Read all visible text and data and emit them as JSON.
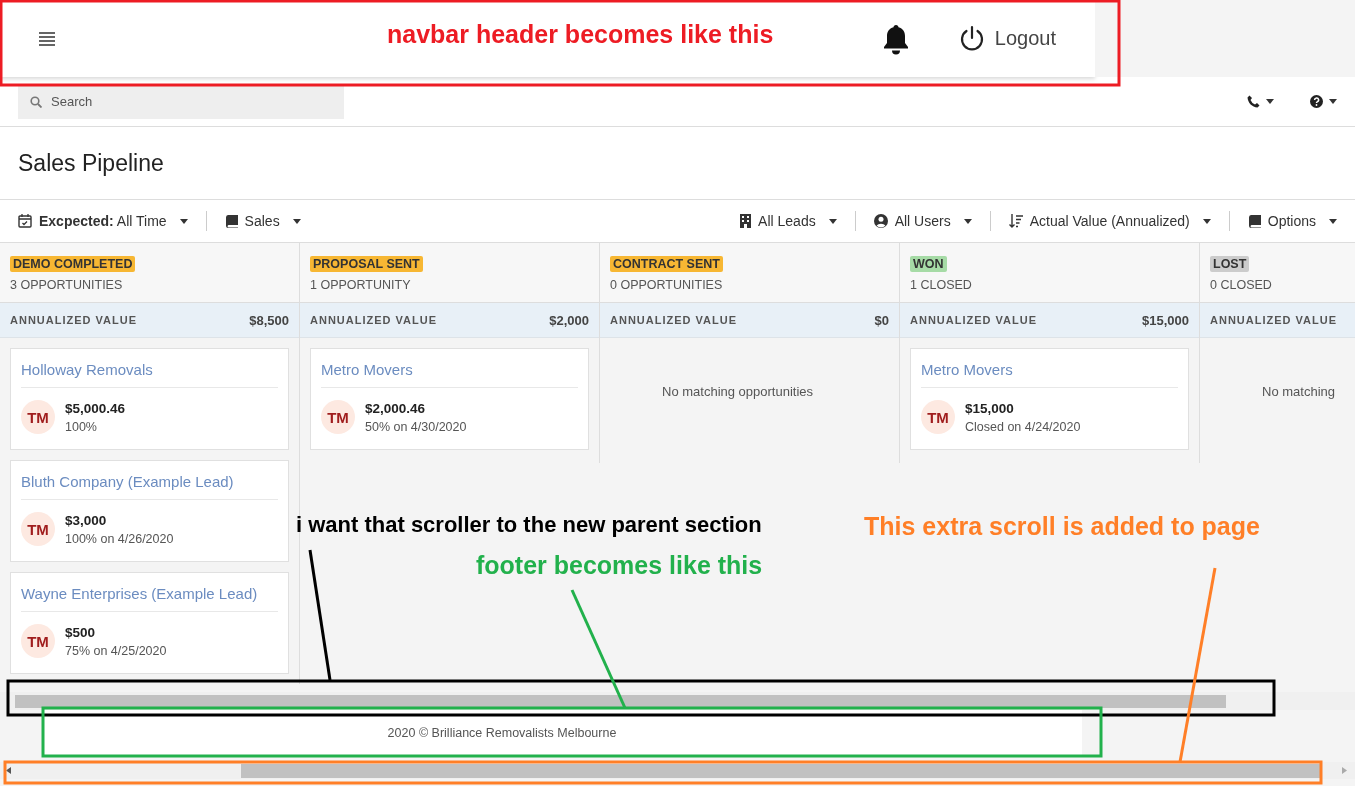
{
  "navbar": {
    "logout": "Logout"
  },
  "search": {
    "placeholder": "Search"
  },
  "page_title": "Sales Pipeline",
  "filters_left": [
    {
      "kind": "calendar",
      "label": "**Excpected:** All Time"
    },
    {
      "kind": "book",
      "label": "Sales"
    }
  ],
  "filters_right": [
    {
      "kind": "building",
      "label": "All Leads"
    },
    {
      "kind": "user",
      "label": "All Users"
    },
    {
      "kind": "sort",
      "label": "Actual Value (Annualized)"
    },
    {
      "kind": "book",
      "label": "Options"
    }
  ],
  "columns": [
    {
      "stage": "DEMO COMPLETED",
      "color": "#f7b733",
      "count": "3 OPPORTUNITIES",
      "value_label": "ANNUALIZED VALUE",
      "value": "$8,500",
      "cards": [
        {
          "title": "Holloway Removals",
          "initials": "TM",
          "amount": "$5,000.46",
          "detail": "100%"
        },
        {
          "title": "Bluth Company (Example Lead)",
          "initials": "TM",
          "amount": "$3,000",
          "detail": "100% on 4/26/2020"
        },
        {
          "title": "Wayne Enterprises (Example Lead)",
          "initials": "TM",
          "amount": "$500",
          "detail": "75% on 4/25/2020"
        }
      ]
    },
    {
      "stage": "PROPOSAL SENT",
      "color": "#f7b733",
      "count": "1 OPPORTUNITY",
      "value_label": "ANNUALIZED VALUE",
      "value": "$2,000",
      "cards": [
        {
          "title": "Metro Movers",
          "initials": "TM",
          "amount": "$2,000.46",
          "detail": "50% on 4/30/2020"
        }
      ]
    },
    {
      "stage": "CONTRACT SENT",
      "color": "#f7b733",
      "count": "0 OPPORTUNITIES",
      "value_label": "ANNUALIZED VALUE",
      "value": "$0",
      "empty": "No matching opportunities"
    },
    {
      "stage": "WON",
      "color": "#a6dba6",
      "count": "1 CLOSED",
      "value_label": "ANNUALIZED VALUE",
      "value": "$15,000",
      "cards": [
        {
          "title": "Metro Movers",
          "initials": "TM",
          "amount": "$15,000",
          "detail": "Closed on 4/24/2020"
        }
      ]
    },
    {
      "stage": "LOST",
      "color": "#cccccc",
      "count": "0 CLOSED",
      "value_label": "ANNUALIZED VALUE",
      "empty": "No matching"
    }
  ],
  "footer": "2020 © Brilliance Removalists Melbourne",
  "annotations": [
    {
      "text": "navbar header becomes like this",
      "color": "#ed1c24"
    },
    {
      "text": "i want that scroller to the new parent section",
      "color": "#000000"
    },
    {
      "text": "footer becomes like this",
      "color": "#22b14c"
    },
    {
      "text": "This extra scroll is added to page",
      "color": "#ff7f27"
    }
  ]
}
